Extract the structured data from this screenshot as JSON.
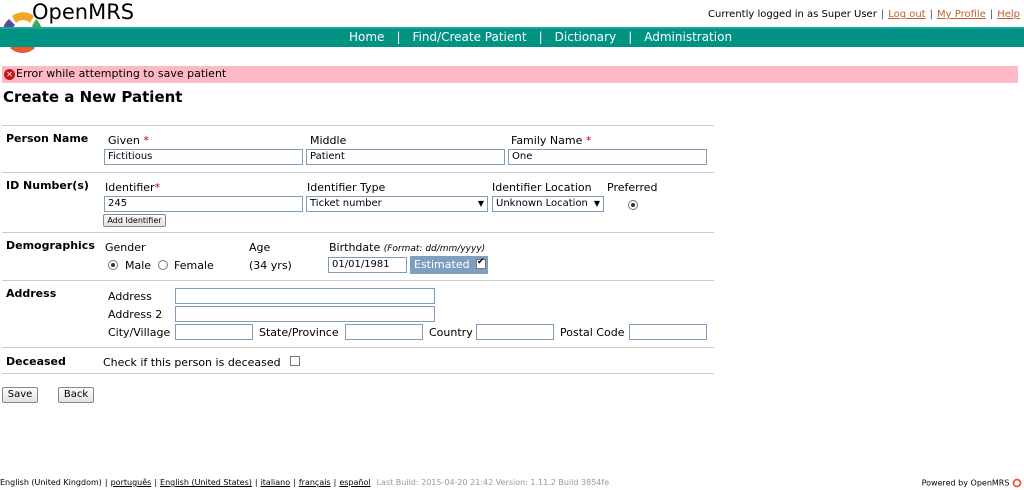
{
  "header": {
    "logo_text": "OpenMRS",
    "logged_in_text": "Currently logged in as Super User",
    "logout": "Log out",
    "my_profile": "My Profile",
    "help": "Help"
  },
  "nav": [
    "Home",
    "Find/Create Patient",
    "Dictionary",
    "Administration"
  ],
  "error": "Error while attempting to save patient",
  "page_title": "Create a New Patient",
  "person_name": {
    "section": "Person Name",
    "given_label": "Given",
    "middle_label": "Middle",
    "family_label": "Family Name",
    "required_mark": "*",
    "given_value": "Fictitious",
    "middle_value": "Patient",
    "family_value": "One"
  },
  "id_numbers": {
    "section": "ID Number(s)",
    "identifier_label": "Identifier",
    "identifier_type_label": "Identifier Type",
    "identifier_location_label": "Identifier Location",
    "preferred_label": "Preferred",
    "identifier_value": "245",
    "identifier_type_value": "Ticket number",
    "identifier_location_value": "Unknown Location",
    "add_identifier": "Add Identifier"
  },
  "demographics": {
    "section": "Demographics",
    "gender_label": "Gender",
    "male": "Male",
    "female": "Female",
    "age_label": "Age",
    "age_value": "(34 yrs)",
    "birthdate_label": "Birthdate",
    "birthdate_format": "(Format: dd/mm/yyyy)",
    "birthdate_value": "01/01/1981",
    "estimated": "Estimated"
  },
  "address": {
    "section": "Address",
    "address_label": "Address",
    "address2_label": "Address 2",
    "city_label": "City/Village",
    "state_label": "State/Province",
    "country_label": "Country",
    "postal_label": "Postal Code"
  },
  "deceased": {
    "section": "Deceased",
    "check_label": "Check if this person is deceased"
  },
  "buttons": {
    "save": "Save",
    "back": "Back"
  },
  "footer": {
    "languages": [
      "English (United Kingdom)",
      "português",
      "English (United States)",
      "italiano",
      "français",
      "español"
    ],
    "build": "Last Build: 2015-04-20 21:42   Version: 1.11.2 Build 3854fe",
    "powered": "Powered by OpenMRS"
  },
  "colors": {
    "nav_bg": "#009384",
    "error_bg": "#ffb9c4",
    "link": "#c06030",
    "estimated_bg": "#7f9fbf"
  }
}
